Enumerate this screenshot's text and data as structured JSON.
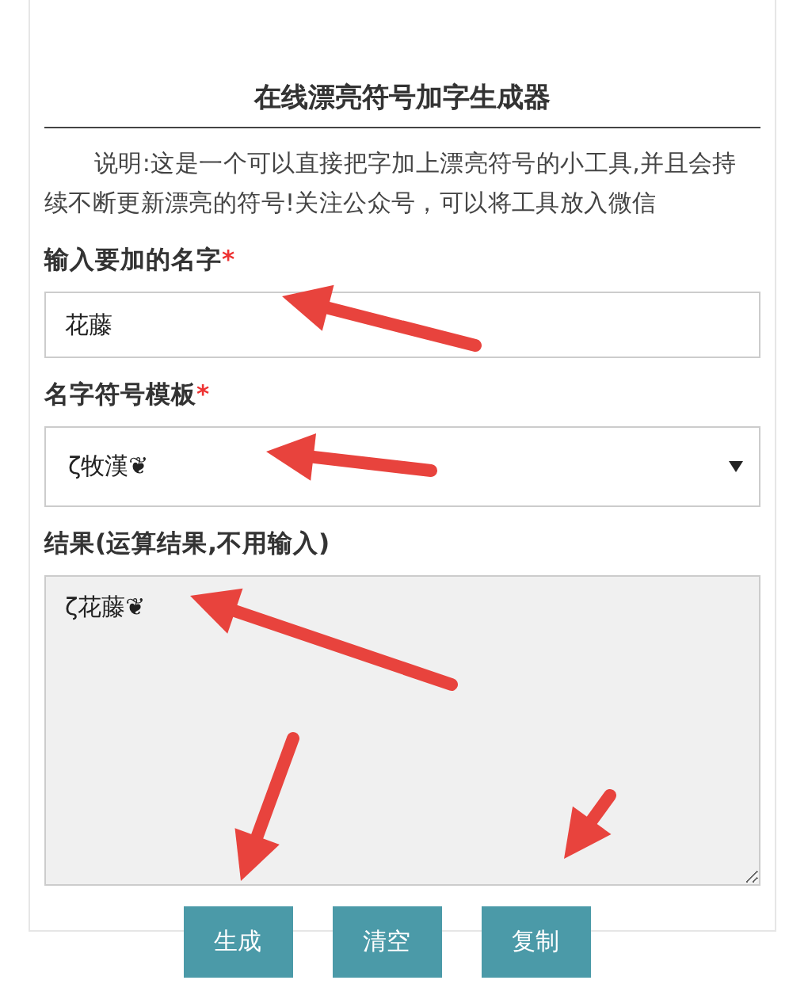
{
  "title": "在线漂亮符号加字生成器",
  "description": "说明:这是一个可以直接把字加上漂亮符号的小工具,并且会持续不断更新漂亮的符号!关注公众号，可以将工具放入微信",
  "fields": [
    {
      "kind": "input",
      "label": "输入要加的名字",
      "required_mark": "*",
      "value": "花藤"
    },
    {
      "kind": "select",
      "label": "名字符号模板",
      "required_mark": "*",
      "value": "ζ牧漢❦"
    },
    {
      "kind": "textarea",
      "label": "结果(运算结果,不用输入)",
      "value": "ζ花藤❦"
    }
  ],
  "buttons": [
    "生成",
    "清空",
    "复制"
  ]
}
